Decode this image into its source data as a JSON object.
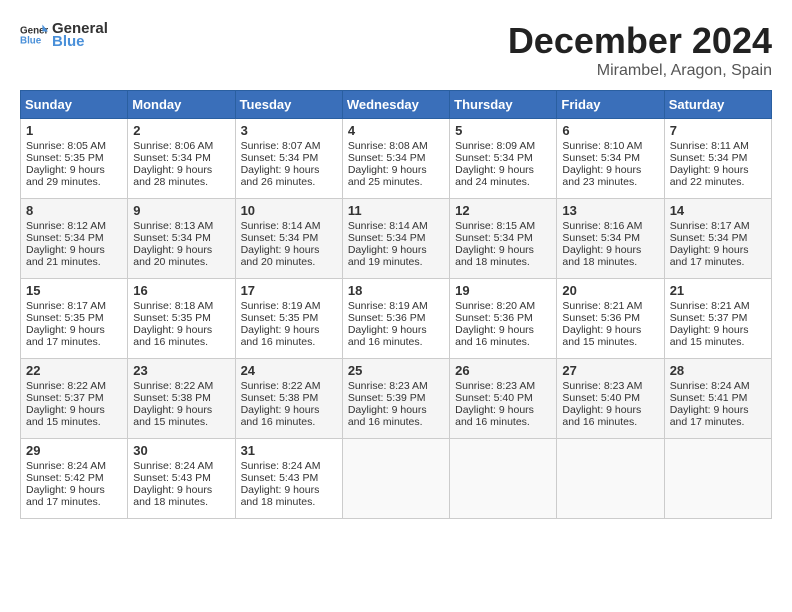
{
  "header": {
    "logo_general": "General",
    "logo_blue": "Blue",
    "month_title": "December 2024",
    "location": "Mirambel, Aragon, Spain"
  },
  "days_of_week": [
    "Sunday",
    "Monday",
    "Tuesday",
    "Wednesday",
    "Thursday",
    "Friday",
    "Saturday"
  ],
  "weeks": [
    [
      {
        "day": "1",
        "sunrise": "8:05 AM",
        "sunset": "5:35 PM",
        "daylight": "9 hours and 29 minutes."
      },
      {
        "day": "2",
        "sunrise": "8:06 AM",
        "sunset": "5:34 PM",
        "daylight": "9 hours and 28 minutes."
      },
      {
        "day": "3",
        "sunrise": "8:07 AM",
        "sunset": "5:34 PM",
        "daylight": "9 hours and 26 minutes."
      },
      {
        "day": "4",
        "sunrise": "8:08 AM",
        "sunset": "5:34 PM",
        "daylight": "9 hours and 25 minutes."
      },
      {
        "day": "5",
        "sunrise": "8:09 AM",
        "sunset": "5:34 PM",
        "daylight": "9 hours and 24 minutes."
      },
      {
        "day": "6",
        "sunrise": "8:10 AM",
        "sunset": "5:34 PM",
        "daylight": "9 hours and 23 minutes."
      },
      {
        "day": "7",
        "sunrise": "8:11 AM",
        "sunset": "5:34 PM",
        "daylight": "9 hours and 22 minutes."
      }
    ],
    [
      {
        "day": "8",
        "sunrise": "8:12 AM",
        "sunset": "5:34 PM",
        "daylight": "9 hours and 21 minutes."
      },
      {
        "day": "9",
        "sunrise": "8:13 AM",
        "sunset": "5:34 PM",
        "daylight": "9 hours and 20 minutes."
      },
      {
        "day": "10",
        "sunrise": "8:14 AM",
        "sunset": "5:34 PM",
        "daylight": "9 hours and 20 minutes."
      },
      {
        "day": "11",
        "sunrise": "8:14 AM",
        "sunset": "5:34 PM",
        "daylight": "9 hours and 19 minutes."
      },
      {
        "day": "12",
        "sunrise": "8:15 AM",
        "sunset": "5:34 PM",
        "daylight": "9 hours and 18 minutes."
      },
      {
        "day": "13",
        "sunrise": "8:16 AM",
        "sunset": "5:34 PM",
        "daylight": "9 hours and 18 minutes."
      },
      {
        "day": "14",
        "sunrise": "8:17 AM",
        "sunset": "5:34 PM",
        "daylight": "9 hours and 17 minutes."
      }
    ],
    [
      {
        "day": "15",
        "sunrise": "8:17 AM",
        "sunset": "5:35 PM",
        "daylight": "9 hours and 17 minutes."
      },
      {
        "day": "16",
        "sunrise": "8:18 AM",
        "sunset": "5:35 PM",
        "daylight": "9 hours and 16 minutes."
      },
      {
        "day": "17",
        "sunrise": "8:19 AM",
        "sunset": "5:35 PM",
        "daylight": "9 hours and 16 minutes."
      },
      {
        "day": "18",
        "sunrise": "8:19 AM",
        "sunset": "5:36 PM",
        "daylight": "9 hours and 16 minutes."
      },
      {
        "day": "19",
        "sunrise": "8:20 AM",
        "sunset": "5:36 PM",
        "daylight": "9 hours and 16 minutes."
      },
      {
        "day": "20",
        "sunrise": "8:21 AM",
        "sunset": "5:36 PM",
        "daylight": "9 hours and 15 minutes."
      },
      {
        "day": "21",
        "sunrise": "8:21 AM",
        "sunset": "5:37 PM",
        "daylight": "9 hours and 15 minutes."
      }
    ],
    [
      {
        "day": "22",
        "sunrise": "8:22 AM",
        "sunset": "5:37 PM",
        "daylight": "9 hours and 15 minutes."
      },
      {
        "day": "23",
        "sunrise": "8:22 AM",
        "sunset": "5:38 PM",
        "daylight": "9 hours and 15 minutes."
      },
      {
        "day": "24",
        "sunrise": "8:22 AM",
        "sunset": "5:38 PM",
        "daylight": "9 hours and 16 minutes."
      },
      {
        "day": "25",
        "sunrise": "8:23 AM",
        "sunset": "5:39 PM",
        "daylight": "9 hours and 16 minutes."
      },
      {
        "day": "26",
        "sunrise": "8:23 AM",
        "sunset": "5:40 PM",
        "daylight": "9 hours and 16 minutes."
      },
      {
        "day": "27",
        "sunrise": "8:23 AM",
        "sunset": "5:40 PM",
        "daylight": "9 hours and 16 minutes."
      },
      {
        "day": "28",
        "sunrise": "8:24 AM",
        "sunset": "5:41 PM",
        "daylight": "9 hours and 17 minutes."
      }
    ],
    [
      {
        "day": "29",
        "sunrise": "8:24 AM",
        "sunset": "5:42 PM",
        "daylight": "9 hours and 17 minutes."
      },
      {
        "day": "30",
        "sunrise": "8:24 AM",
        "sunset": "5:43 PM",
        "daylight": "9 hours and 18 minutes."
      },
      {
        "day": "31",
        "sunrise": "8:24 AM",
        "sunset": "5:43 PM",
        "daylight": "9 hours and 18 minutes."
      },
      null,
      null,
      null,
      null
    ]
  ]
}
